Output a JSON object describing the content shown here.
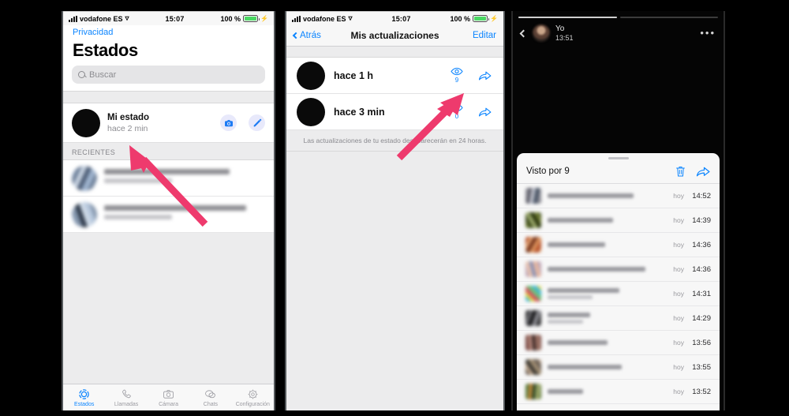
{
  "phone1": {
    "statusbar": {
      "carrier": "vodafone ES",
      "time": "15:07",
      "battery_pct": "100 %",
      "wifi_icon": "wifi-icon",
      "signal_icon": "signal-bars-icon",
      "charging_icon": "charging-bolt-icon"
    },
    "back_link": "Privacidad",
    "title": "Estados",
    "search": {
      "placeholder": "Buscar",
      "icon": "search-icon"
    },
    "my_status": {
      "name": "Mi estado",
      "subtitle": "hace 2 min",
      "camera_icon": "camera-icon",
      "pencil_icon": "pencil-icon",
      "avatar_icon": "avatar"
    },
    "section_header": "RECIENTES",
    "recents": [
      {
        "name": "",
        "subtitle": ""
      },
      {
        "name": "",
        "subtitle": ""
      }
    ],
    "tabs": [
      {
        "label": "Estados",
        "icon": "status-rings-icon",
        "active": true
      },
      {
        "label": "Llamadas",
        "icon": "phone-icon",
        "active": false
      },
      {
        "label": "Cámara",
        "icon": "camera-icon",
        "active": false
      },
      {
        "label": "Chats",
        "icon": "chat-bubbles-icon",
        "active": false
      },
      {
        "label": "Configuración",
        "icon": "gear-icon",
        "active": false
      }
    ]
  },
  "phone2": {
    "statusbar": {
      "carrier": "vodafone ES",
      "time": "15:07",
      "battery_pct": "100 %"
    },
    "back_label": "Atrás",
    "title": "Mis actualizaciones",
    "edit_label": "Editar",
    "updates": [
      {
        "label": "hace 1 h",
        "views": "9",
        "eye_icon": "eye-icon",
        "forward_icon": "forward-arrow-icon"
      },
      {
        "label": "hace 3 min",
        "views": "0",
        "eye_icon": "eye-icon",
        "forward_icon": "forward-arrow-icon"
      }
    ],
    "footer_note": "Las actualizaciones de tu estado desaparecerán en 24 horas."
  },
  "phone3": {
    "progress_segments": [
      100,
      0
    ],
    "header": {
      "name": "Yo",
      "time": "13:51",
      "back_icon": "chevron-left-icon",
      "more_icon": "more-options-icon",
      "avatar": "avatar"
    },
    "sheet": {
      "title": "Visto por 9",
      "delete_icon": "trash-icon",
      "forward_icon": "forward-arrow-icon",
      "viewers": [
        {
          "name": "",
          "when": "hoy",
          "time": "14:52"
        },
        {
          "name": "",
          "when": "hoy",
          "time": "14:39"
        },
        {
          "name": "",
          "when": "hoy",
          "time": "14:36"
        },
        {
          "name": "",
          "when": "hoy",
          "time": "14:36"
        },
        {
          "name": "",
          "when": "hoy",
          "time": "14:31"
        },
        {
          "name": "",
          "when": "hoy",
          "time": "14:29"
        },
        {
          "name": "",
          "when": "hoy",
          "time": "13:56"
        },
        {
          "name": "",
          "when": "hoy",
          "time": "13:55"
        },
        {
          "name": "",
          "when": "hoy",
          "time": "13:52"
        }
      ]
    }
  },
  "annotations": {
    "arrow_color": "#ee3a6d",
    "arrows": [
      {
        "name": "arrow-to-mi-estado-time"
      },
      {
        "name": "arrow-to-view-count"
      }
    ]
  },
  "colors": {
    "accent_blue": "#0a84ff",
    "arrow_pink": "#ee3a6d",
    "battery_green": "#4cd964"
  }
}
